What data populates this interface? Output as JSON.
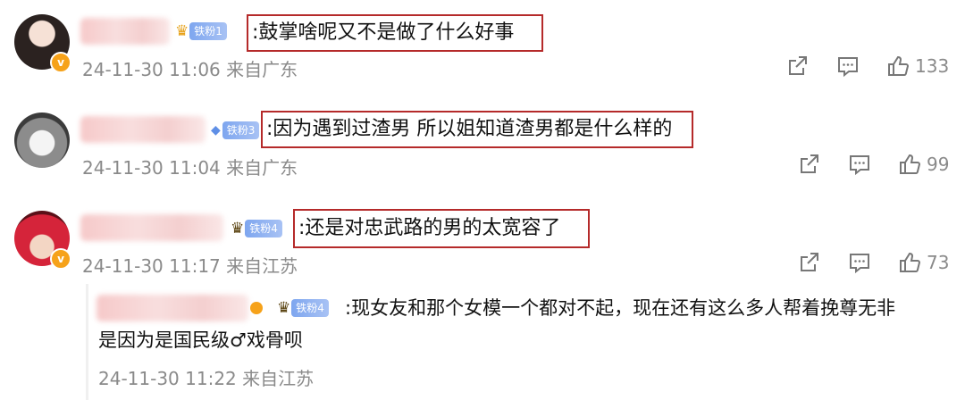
{
  "comments": [
    {
      "fan_label": "铁粉1",
      "text": ":鼓掌啥呢又不是做了什么好事",
      "meta": "24-11-30 11:06 来自广东",
      "likes": "133",
      "verified_mark": "v"
    },
    {
      "fan_label": "铁粉3",
      "text": ":因为遇到过渣男 所以姐知道渣男都是什么样的",
      "meta": "24-11-30 11:04 来自广东",
      "likes": "99"
    },
    {
      "fan_label": "铁粉4",
      "text": ":还是对忠武路的男的太宽容了",
      "meta": "24-11-30 11:17 来自江苏",
      "likes": "73",
      "verified_mark": "v"
    }
  ],
  "reply": {
    "fan_label": "铁粉4",
    "text_line1": ":现女友和那个女模一个都对不起，现在还有这么多人帮着挽尊无非",
    "text_line2": "是因为是国民级♂戏骨呗",
    "meta": "24-11-30 11:22 来自江苏"
  },
  "icons": [
    "share-icon",
    "comment-icon",
    "like-icon",
    "crown-icon",
    "diamond-icon"
  ],
  "colors": {
    "highlight_box": "#b52a2a",
    "meta_text": "#8a8a8a",
    "fan_tag": "#7ea6ef"
  }
}
